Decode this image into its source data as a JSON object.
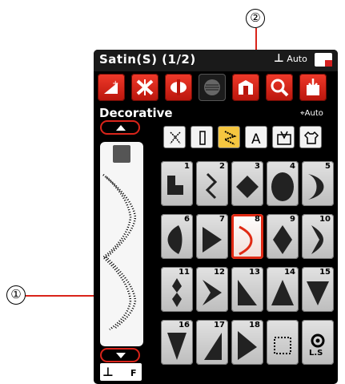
{
  "callouts": {
    "one": "①",
    "two": "②"
  },
  "header": {
    "title": "Satin(S) (1/2)",
    "foot_mode": "Auto"
  },
  "toolbar": {
    "tools": [
      "elongation-icon",
      "mirror-icon",
      "twin-needle-icon",
      "memory-icon",
      "program-icon",
      "zoom-icon",
      "save-icon"
    ]
  },
  "mode": {
    "label": "Decorative",
    "auto": "Auto"
  },
  "sidebar": {
    "foot_label": "F"
  },
  "categories": [
    "satin-category",
    "straight-category",
    "decorative-category",
    "letters-category",
    "quilt-category",
    "apparel-category"
  ],
  "patterns": [
    {
      "num": "1"
    },
    {
      "num": "2"
    },
    {
      "num": "3"
    },
    {
      "num": "4"
    },
    {
      "num": "5"
    },
    {
      "num": "6"
    },
    {
      "num": "7"
    },
    {
      "num": "8"
    },
    {
      "num": "9"
    },
    {
      "num": "10"
    },
    {
      "num": "11"
    },
    {
      "num": "12"
    },
    {
      "num": "13"
    },
    {
      "num": "14"
    },
    {
      "num": "15"
    },
    {
      "num": "16"
    },
    {
      "num": "17"
    },
    {
      "num": "18"
    },
    {
      "num": ""
    },
    {
      "num": ""
    }
  ],
  "ls_label": "L.S",
  "accent": "#e02a14",
  "selected_pattern": "8"
}
